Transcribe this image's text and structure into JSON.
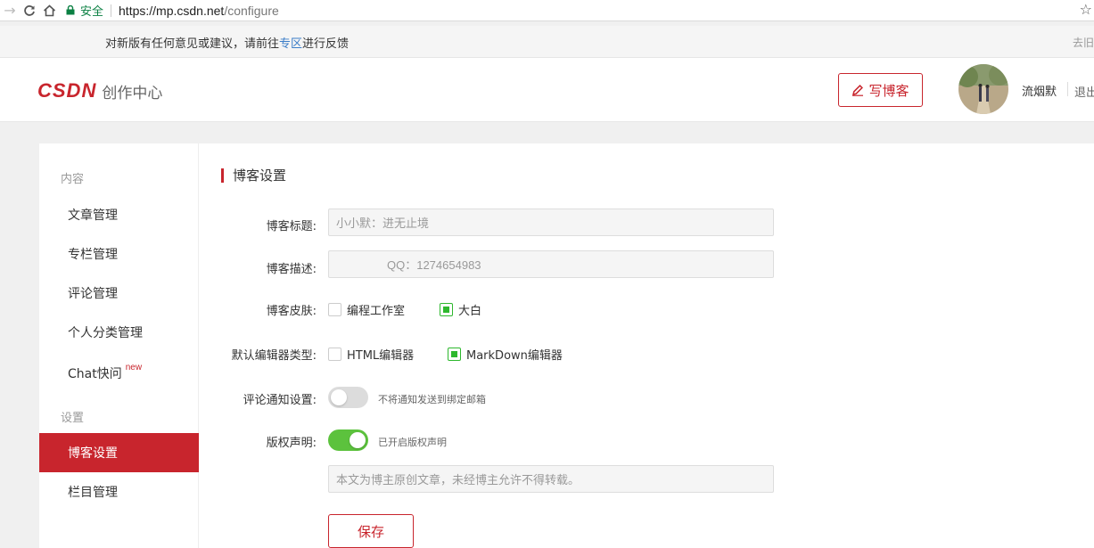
{
  "browser": {
    "secure_label": "安全",
    "url_host": "https://mp.csdn.net",
    "url_path": "/configure"
  },
  "notice": {
    "text_before": "对新版有任何意见或建议，请前往",
    "link": "专区",
    "text_after": "进行反馈",
    "old_version": "去旧"
  },
  "header": {
    "brand": "CSDN",
    "subtitle": "创作中心",
    "write_label": "写博客",
    "username": "流烟默",
    "logout": "退出"
  },
  "sidebar": {
    "group_content": "内容",
    "items": [
      {
        "label": "文章管理"
      },
      {
        "label": "专栏管理"
      },
      {
        "label": "评论管理"
      },
      {
        "label": "个人分类管理"
      },
      {
        "label": "Chat快问",
        "badge": "new"
      }
    ],
    "group_settings": "设置",
    "settings_items": [
      {
        "label": "博客设置",
        "active": true
      },
      {
        "label": "栏目管理"
      }
    ]
  },
  "form": {
    "section_title": "博客设置",
    "title_label": "博客标题:",
    "title_value": "小小默：进无止境",
    "desc_label": "博客描述:",
    "desc_value": "QQ：1274654983",
    "skin_label": "博客皮肤:",
    "skin_options": [
      {
        "label": "编程工作室",
        "checked": false
      },
      {
        "label": "大白",
        "checked": true
      }
    ],
    "editor_label": "默认编辑器类型:",
    "editor_options": [
      {
        "label": "HTML编辑器",
        "checked": false
      },
      {
        "label": "MarkDown编辑器",
        "checked": true
      }
    ],
    "notify_label": "评论通知设置:",
    "notify_on": false,
    "notify_text": "不将通知发送到绑定邮箱",
    "copyright_label": "版权声明:",
    "copyright_on": true,
    "copyright_text": "已开启版权声明",
    "copyright_value": "本文为博主原创文章，未经博主允许不得转载。",
    "save_label": "保存"
  },
  "colors": {
    "brand_red": "#c8252d",
    "toggle_green": "#5cc23d",
    "check_green": "#2eb82e"
  }
}
